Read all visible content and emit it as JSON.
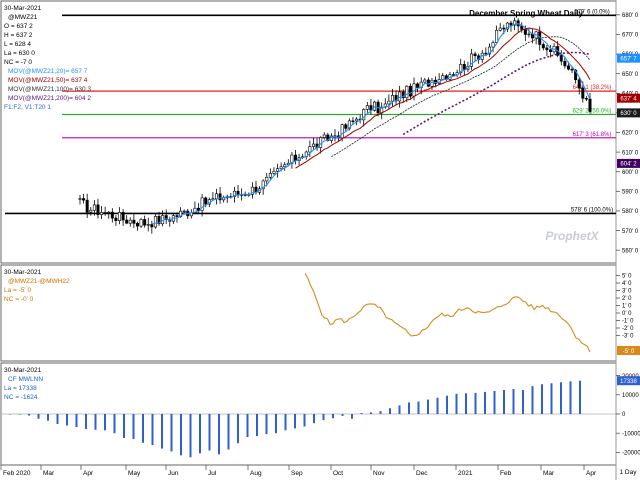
{
  "header": {
    "title": "December Spring Wheat Daily",
    "date": "30-Mar-2021",
    "symbol": "@MWZ21",
    "stats": [
      "O = 637 2",
      "H = 637 2",
      "L = 628 4",
      "La = 630 0",
      "NC = -7 0"
    ],
    "studies": [
      "MOV(@MWZ21,20)= 657 7",
      "MOV(@MWZ21,50)= 637 4",
      "MOV(@MWZ21,100)= 630 3",
      "MOV(@MWZ21,200)= 604 2",
      "F1:F2, V1:T20 1"
    ]
  },
  "price_levels": [
    {
      "label": "679' 6 (0.0%)",
      "value": 679.75,
      "color": "#000000"
    },
    {
      "label": "641' 1 (38.2%)",
      "value": 641.1,
      "color": "#e02020"
    },
    {
      "label": "629' 2 (50.0%)",
      "value": 629.2,
      "color": "#20b020"
    },
    {
      "label": "617' 3 (61.8%)",
      "value": 617.3,
      "color": "#c000c0"
    },
    {
      "label": "578' 6 (100.0%)",
      "value": 578.75,
      "color": "#000000"
    }
  ],
  "price_ticks": [
    "680' 0",
    "670' 0",
    "660' 0",
    "650' 0",
    "640' 0",
    "630' 0",
    "620' 0",
    "610' 0",
    "600' 0",
    "590' 0",
    "580' 0",
    "570' 0",
    "560' 0"
  ],
  "price_tags": [
    {
      "label": "657' 7",
      "value": 657.9,
      "bg": "#1e90ff"
    },
    {
      "label": "637' 4",
      "value": 637.5,
      "bg": "#a00000"
    },
    {
      "label": "630' 0",
      "value": 630.0,
      "bg": "#1a1a1a"
    },
    {
      "label": "604' 2",
      "value": 604.25,
      "bg": "#400060"
    }
  ],
  "watermark": "ProphetX",
  "spread_panel": {
    "date": "30-Mar-2021",
    "symbol": "@MWZ21-@MWH22",
    "stats": [
      "La = -5' 0",
      "NC = -0' 0"
    ],
    "ticks": [
      "5' 0",
      "4' 0",
      "3' 0",
      "2' 0",
      "1' 0",
      "0' 0",
      "-1' 0",
      "-2' 0",
      "-3' 0"
    ],
    "last_tag": "-5' 0"
  },
  "cot_panel": {
    "date": "30-Mar-2021",
    "symbol": "CF MWLNN",
    "stats": [
      "La = 17338",
      "NC = -1624"
    ],
    "ticks": [
      "20000",
      "10000",
      "0",
      "-10000",
      "-20000"
    ],
    "last_tag": "17338"
  },
  "time_axis": {
    "labels": [
      "Feb 2020",
      "Mar",
      "Apr",
      "May",
      "Jun",
      "Jul",
      "Aug",
      "Sep",
      "Oct",
      "Nov",
      "Dec",
      "2021",
      "Feb",
      "Mar",
      "Apr"
    ],
    "period": "1 Day"
  },
  "chart_data": [
    {
      "type": "candlestick",
      "title": "December Spring Wheat Daily",
      "ylim": [
        555,
        685
      ],
      "fibonacci_levels": [
        679.75,
        641.1,
        629.2,
        617.3,
        578.75
      ],
      "anchors_weekly_close": [
        [
          0,
          584
        ],
        [
          3,
          581
        ],
        [
          6,
          580
        ],
        [
          9,
          578
        ],
        [
          12,
          576
        ],
        [
          15,
          575
        ],
        [
          18,
          574
        ],
        [
          21,
          575
        ],
        [
          24,
          576
        ],
        [
          27,
          578
        ],
        [
          30,
          580
        ],
        [
          33,
          583
        ],
        [
          36,
          585
        ],
        [
          39,
          587
        ],
        [
          42,
          588
        ],
        [
          45,
          589
        ],
        [
          48,
          591
        ],
        [
          51,
          594
        ],
        [
          54,
          598
        ],
        [
          57,
          603
        ],
        [
          60,
          607
        ],
        [
          63,
          611
        ],
        [
          66,
          614
        ],
        [
          69,
          617
        ],
        [
          72,
          620
        ],
        [
          75,
          624
        ],
        [
          78,
          629
        ],
        [
          81,
          633
        ],
        [
          84,
          632
        ],
        [
          87,
          637
        ],
        [
          90,
          640
        ],
        [
          93,
          642
        ],
        [
          96,
          645
        ],
        [
          99,
          648
        ],
        [
          102,
          650
        ],
        [
          105,
          652
        ],
        [
          108,
          656
        ],
        [
          111,
          660
        ],
        [
          114,
          664
        ],
        [
          117,
          672
        ],
        [
          120,
          676
        ],
        [
          123,
          672
        ],
        [
          126,
          671
        ],
        [
          129,
          666
        ],
        [
          132,
          661
        ],
        [
          135,
          655
        ],
        [
          138,
          647
        ],
        [
          140,
          640
        ],
        [
          142,
          630
        ]
      ],
      "moving_averages": [
        {
          "name": "MOV(@MWZ21,20)",
          "last": 657.9,
          "color": "#1e90ff"
        },
        {
          "name": "MOV(@MWZ21,50)",
          "last": 637.5,
          "color": "#a00000"
        },
        {
          "name": "MOV(@MWZ21,100)",
          "last": 630.3,
          "color": "#333333"
        },
        {
          "name": "MOV(@MWZ21,200)",
          "last": 604.25,
          "color": "#5a1a7a"
        }
      ]
    },
    {
      "type": "line",
      "name": "@MWZ21-@MWH22",
      "ylim": [
        -6,
        6
      ],
      "anchors": [
        [
          0,
          5.3
        ],
        [
          3,
          2.8
        ],
        [
          6,
          0.0
        ],
        [
          9,
          -1.5
        ],
        [
          12,
          -0.8
        ],
        [
          15,
          -1.2
        ],
        [
          18,
          -0.2
        ],
        [
          21,
          0.8
        ],
        [
          24,
          1.2
        ],
        [
          27,
          0.5
        ],
        [
          30,
          -0.8
        ],
        [
          33,
          -1.6
        ],
        [
          36,
          -2.4
        ],
        [
          38,
          -3.2
        ],
        [
          40,
          -2.8
        ],
        [
          43,
          -2.2
        ],
        [
          46,
          -0.8
        ],
        [
          49,
          -0.2
        ],
        [
          52,
          -0.5
        ],
        [
          55,
          0.3
        ],
        [
          58,
          0.8
        ],
        [
          61,
          0.2
        ],
        [
          64,
          -0.1
        ],
        [
          67,
          0.3
        ],
        [
          70,
          0.9
        ],
        [
          73,
          1.6
        ],
        [
          76,
          2.2
        ],
        [
          79,
          1.4
        ],
        [
          82,
          0.6
        ],
        [
          85,
          1.0
        ],
        [
          88,
          0.4
        ],
        [
          91,
          -0.2
        ],
        [
          94,
          -1.3
        ],
        [
          97,
          -3.1
        ],
        [
          100,
          -4.2
        ],
        [
          102,
          -5.0
        ]
      ]
    },
    {
      "type": "bar",
      "name": "CF MWLNN",
      "ylim": [
        -25000,
        25000
      ],
      "values": [
        -200,
        -300,
        -800,
        -2500,
        -3500,
        -5200,
        -6000,
        -6800,
        -7800,
        -8200,
        -8500,
        -10000,
        -12500,
        -13000,
        -15000,
        -16200,
        -18000,
        -19500,
        -21500,
        -22500,
        -20500,
        -19000,
        -21000,
        -18500,
        -15200,
        -12000,
        -11500,
        -10500,
        -10000,
        -8500,
        -7500,
        -6500,
        -4800,
        -3200,
        -2200,
        -1000,
        -2500,
        500,
        800,
        1500,
        3000,
        4500,
        6000,
        6500,
        7500,
        8500,
        9500,
        10500,
        10800,
        11000,
        11500,
        12000,
        12500,
        13000,
        12500,
        14500,
        15500,
        16000,
        16500,
        17000,
        17338
      ]
    }
  ]
}
